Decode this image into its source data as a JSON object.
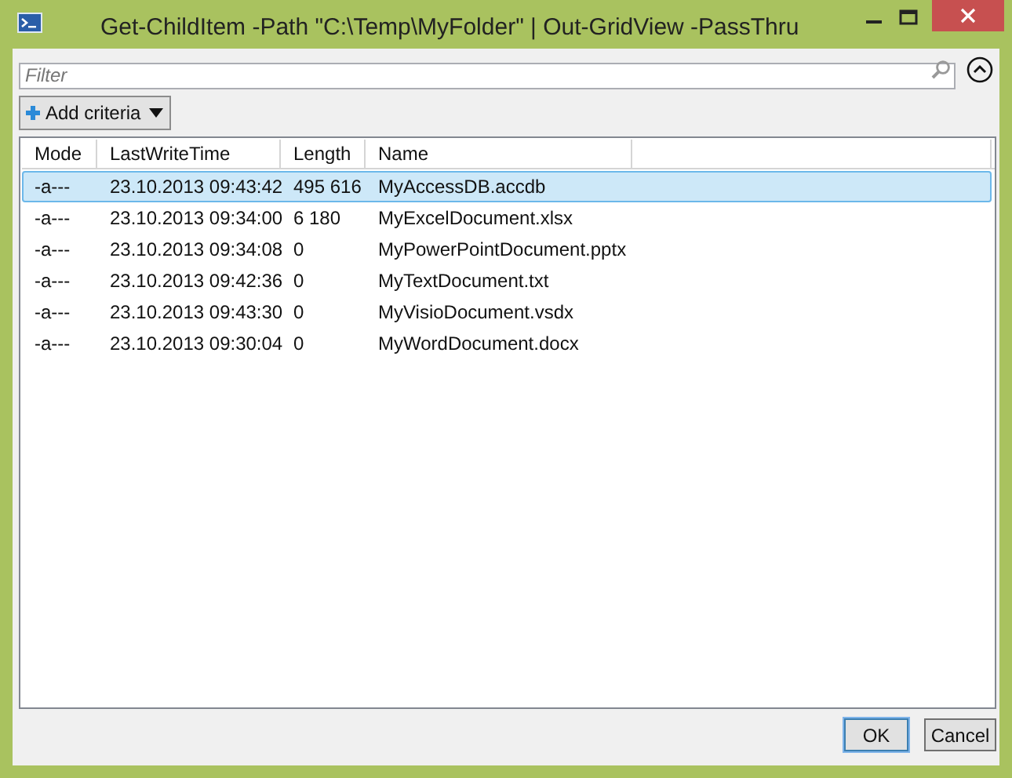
{
  "window": {
    "title": "Get-ChildItem -Path \"C:\\Temp\\MyFolder\" | Out-GridView -PassThru"
  },
  "filter": {
    "placeholder": "Filter"
  },
  "add_criteria": {
    "label": "Add criteria"
  },
  "table": {
    "columns": [
      "Mode",
      "LastWriteTime",
      "Length",
      "Name"
    ],
    "rows": [
      {
        "cells": [
          "-a---",
          "23.10.2013 09:43:42",
          "495 616",
          "MyAccessDB.accdb"
        ],
        "selected": true
      },
      {
        "cells": [
          "-a---",
          "23.10.2013 09:34:00",
          "6 180",
          "MyExcelDocument.xlsx"
        ],
        "selected": false
      },
      {
        "cells": [
          "-a---",
          "23.10.2013 09:34:08",
          "0",
          "MyPowerPointDocument.pptx"
        ],
        "selected": false
      },
      {
        "cells": [
          "-a---",
          "23.10.2013 09:42:36",
          "0",
          "MyTextDocument.txt"
        ],
        "selected": false
      },
      {
        "cells": [
          "-a---",
          "23.10.2013 09:43:30",
          "0",
          "MyVisioDocument.vsdx"
        ],
        "selected": false
      },
      {
        "cells": [
          "-a---",
          "23.10.2013 09:30:04",
          "0",
          "MyWordDocument.docx"
        ],
        "selected": false
      }
    ]
  },
  "buttons": [
    {
      "label": "OK",
      "default": true
    },
    {
      "label": "Cancel",
      "default": false
    }
  ]
}
